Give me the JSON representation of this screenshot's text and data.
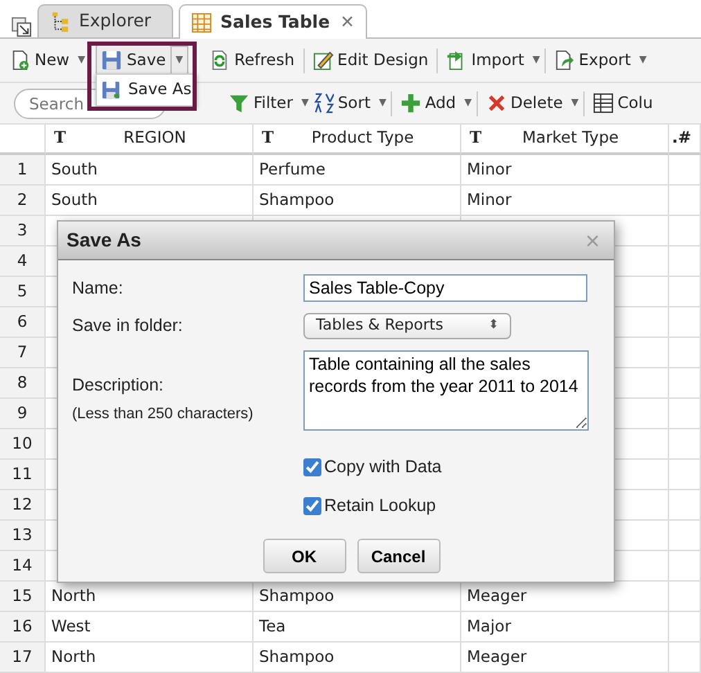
{
  "tabs": [
    {
      "label": "Explorer",
      "kind": "folder-tree",
      "selected": false
    },
    {
      "label": "Sales Table",
      "kind": "grid",
      "selected": true,
      "close": "✕"
    }
  ],
  "toolbar": [
    {
      "label": "New",
      "kind": "new",
      "caret": "▼"
    },
    {
      "label": "Save",
      "kind": "save",
      "caret": "▼",
      "highlighted": true
    },
    {
      "label": "Refresh",
      "kind": "refresh"
    },
    {
      "label": "Edit Design",
      "kind": "edit"
    },
    {
      "label": "Import",
      "kind": "import",
      "caret": "▼"
    },
    {
      "label": "Export",
      "kind": "export",
      "caret": "▼"
    }
  ],
  "save_menu": {
    "items": [
      {
        "label": "Save As",
        "kind": "saveas"
      }
    ]
  },
  "search": {
    "placeholder": "Search"
  },
  "toolbar2": [
    {
      "label": "Filter",
      "kind": "filter",
      "caret": "▼"
    },
    {
      "label": "Sort",
      "kind": "sort",
      "caret": "▼"
    },
    {
      "label": "Add",
      "kind": "add",
      "caret": "▼"
    },
    {
      "label": "Delete",
      "kind": "delete",
      "caret": "▼"
    },
    {
      "label": "Colu",
      "kind": "columns"
    }
  ],
  "table": {
    "columns": [
      {
        "label": "REGION",
        "type": "T"
      },
      {
        "label": "Product Type",
        "type": "T"
      },
      {
        "label": "Market Type",
        "type": "T"
      },
      {
        "label": ".#"
      }
    ],
    "rows": [
      {
        "num": "1",
        "cells": [
          "South",
          "Perfume",
          "Minor"
        ]
      },
      {
        "num": "2",
        "cells": [
          "South",
          "Shampoo",
          "Minor"
        ]
      },
      {
        "num": "3",
        "cells": []
      },
      {
        "num": "4",
        "cells": []
      },
      {
        "num": "5",
        "cells": []
      },
      {
        "num": "6",
        "cells": []
      },
      {
        "num": "7",
        "cells": []
      },
      {
        "num": "8",
        "cells": []
      },
      {
        "num": "9",
        "cells": []
      },
      {
        "num": "10",
        "cells": []
      },
      {
        "num": "11",
        "cells": []
      },
      {
        "num": "12",
        "cells": []
      },
      {
        "num": "13",
        "cells": []
      },
      {
        "num": "14",
        "cells": []
      },
      {
        "num": "15",
        "cells": [
          "North",
          "Shampoo",
          "Meager"
        ]
      },
      {
        "num": "16",
        "cells": [
          "West",
          "Tea",
          "Major"
        ]
      },
      {
        "num": "17",
        "cells": [
          "North",
          "Shampoo",
          "Meager"
        ]
      }
    ]
  },
  "dialog": {
    "title": "Save As",
    "close": "×",
    "name_label": "Name:",
    "name_value": "Sales Table-Copy",
    "folder_label": "Save in folder:",
    "folder_value": "Tables & Reports",
    "folder_arrows": "⬍",
    "description_label": "Description:",
    "description_hint": "(Less than 250 characters)",
    "description_value": "Table containing all the sales records from the year 2011 to 2014",
    "checkboxes": [
      {
        "label": "Copy with Data",
        "checked": true
      },
      {
        "label": "Retain Lookup",
        "checked": true
      }
    ],
    "buttons": [
      "OK",
      "Cancel"
    ]
  }
}
